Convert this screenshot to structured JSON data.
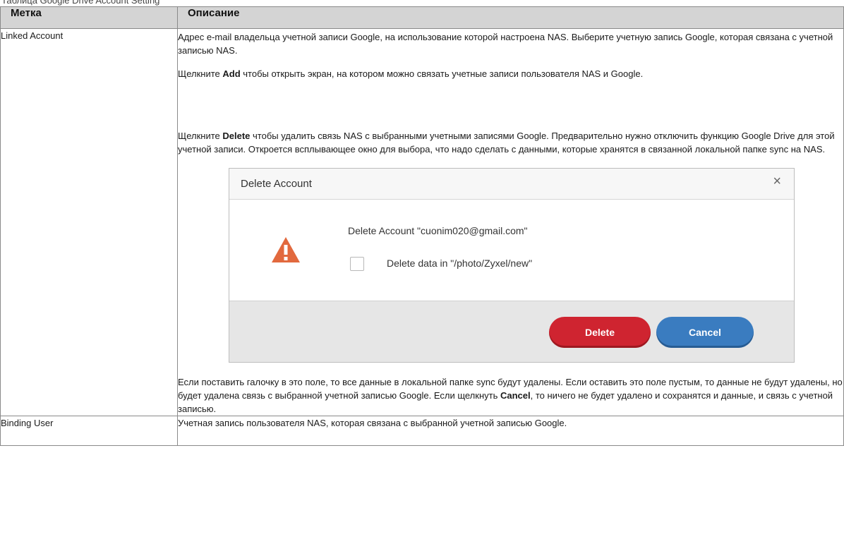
{
  "caption": "Таблица Google Drive Account Setting",
  "table": {
    "headers": [
      "Метка",
      "Описание"
    ],
    "rows": [
      {
        "label": "Linked Account",
        "p1": "Адрес e-mail владельца учетной записи Google, на использование которой настроена NAS. Выберите учетную запись Google, которая связана с учетной записью NAS.",
        "p2_bold": "Add",
        "p2_text": " чтобы открыть экран, на котором можно связать учетные записи пользователя NAS и Google.",
        "p3_bold": "Delete",
        "p3_text": " чтобы удалить связь NAS с выбранными учетными записями Google. Предварительно нужно отключить функцию Google Drive для этой учетной записи. Откроется всплывающее окно для выбора, что надо сделать с данными, которые хранятся в связанной локальной папке sync на NAS.",
        "p4_text": "Если поставить галочку в это поле, то все данные в локальной папке sync будут удалены. Если оставить это поле пустым, то данные не будут удалены, но будет удалена связь с выбранной учетной записью Google. Если щелкнуть ",
        "p4_bold": "Cancel",
        "p4_tail": ", то ничего не будет удалено и сохранятся и данные, и связь с учетной записью."
      },
      {
        "label": "Binding User",
        "desc": "Учетная запись пользователя NAS, которая связана с выбранной учетной записью Google."
      }
    ],
    "click_word": "Щелкните "
  },
  "dialog": {
    "title": "Delete Account",
    "close": "×",
    "message": "Delete Account \"cuonim020@gmail.com\"",
    "checkbox_label": "Delete data in \"/photo/Zyxel/new\"",
    "delete_button": "Delete",
    "cancel_button": "Cancel",
    "warning_icon": "warning-triangle-icon",
    "colors": {
      "warning": "#e2693e",
      "delete": "#cf2430",
      "cancel": "#3a7cc0"
    }
  }
}
